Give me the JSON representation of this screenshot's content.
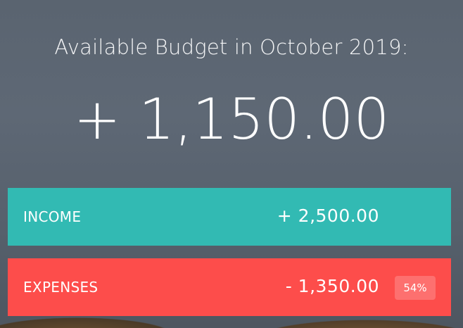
{
  "header": {
    "title": "Available Budget in October 2019:",
    "budget": "+ 1,150.00"
  },
  "income": {
    "label": "INCOME",
    "value": "+ 2,500.00",
    "color": "#32bab3"
  },
  "expenses": {
    "label": "EXPENSES",
    "value": "- 1,350.00",
    "percentage": "54%",
    "color": "#fd4d4b"
  }
}
